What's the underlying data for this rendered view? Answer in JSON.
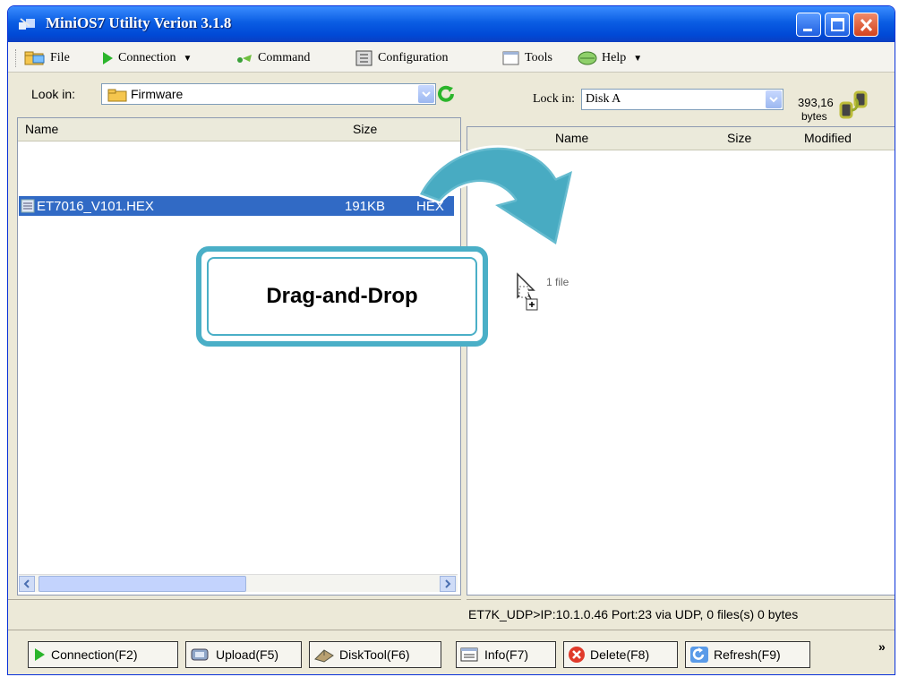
{
  "window": {
    "title": "MiniOS7 Utility Verion 3.1.8"
  },
  "menu": {
    "file": "File",
    "connection": "Connection",
    "command": "Command",
    "configuration": "Configuration",
    "tools": "Tools",
    "help": "Help"
  },
  "left_pane": {
    "look_in_label": "Look in:",
    "look_in_value": "Firmware",
    "columns": {
      "name": "Name",
      "size": "Size"
    },
    "files": [
      {
        "name": "ET7016_V101.HEX",
        "size": "191KB",
        "type": "HEX"
      }
    ]
  },
  "right_pane": {
    "look_in_label": "Lock in:",
    "look_in_value": "Disk A",
    "free_space": "393,16",
    "free_unit": "bytes",
    "columns": {
      "name": "Name",
      "size": "Size",
      "modified": "Modified"
    },
    "drag_label": "1 file",
    "status": "ET7K_UDP>IP:10.1.0.46 Port:23 via UDP, 0 files(s) 0 bytes"
  },
  "toolbar": {
    "connection": "Connection(F2)",
    "upload": "Upload(F5)",
    "disktool": "DiskTool(F6)",
    "info": "Info(F7)",
    "delete": "Delete(F8)",
    "refresh": "Refresh(F9)",
    "more": "»"
  },
  "overlay": {
    "text": "Drag-and-Drop",
    "accent": "#4AAFC7"
  },
  "colors": {
    "titlebar": "#0A5DE3",
    "selection": "#316AC5",
    "chrome": "#ECE9D8"
  }
}
